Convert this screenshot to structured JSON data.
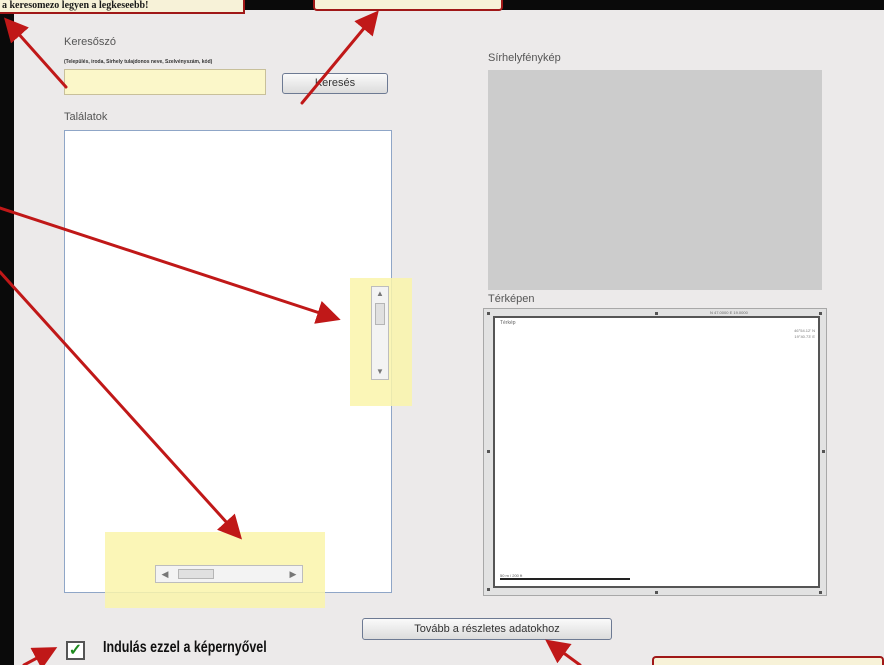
{
  "annotation": {
    "top_note": "a keresomezo legyen a legkeseebb!"
  },
  "search": {
    "label": "Keresőszó",
    "hint": "(Település, iroda, Sirhely tulajdonos neve, Szelvényszám, kód)",
    "value": "",
    "button": "Keresés"
  },
  "results": {
    "label": "Találatok",
    "up_arrow": "▲",
    "down_arrow": "▼",
    "left_arrow": "◀",
    "right_arrow": "▶"
  },
  "photo": {
    "label": "Sírhelyfénykép"
  },
  "map": {
    "label": "Térképen",
    "title": "Térkép",
    "top_text": "N 47.0000  E 19.0000",
    "coords": [
      "46°54.12' N",
      "19°40.73' E"
    ],
    "scale": "50 m / 200 ft"
  },
  "next_button": "Tovább a részletes adatokhoz",
  "startup": {
    "checked": true,
    "check_mark": "✓",
    "label": "Indulás ezzel a képernyővel"
  },
  "colors": {
    "accent_arrow": "#c01818",
    "highlight": "#faf4aa",
    "check": "#1e8a1e"
  }
}
